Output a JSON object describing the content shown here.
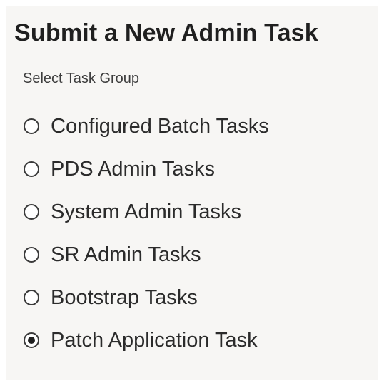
{
  "form": {
    "title": "Submit a New Admin Task",
    "group_label": "Select Task Group",
    "options": [
      {
        "label": "Configured Batch Tasks",
        "selected": false
      },
      {
        "label": "PDS Admin Tasks",
        "selected": false
      },
      {
        "label": "System Admin Tasks",
        "selected": false
      },
      {
        "label": "SR Admin Tasks",
        "selected": false
      },
      {
        "label": "Bootstrap Tasks",
        "selected": false
      },
      {
        "label": "Patch Application Task",
        "selected": true
      }
    ]
  }
}
